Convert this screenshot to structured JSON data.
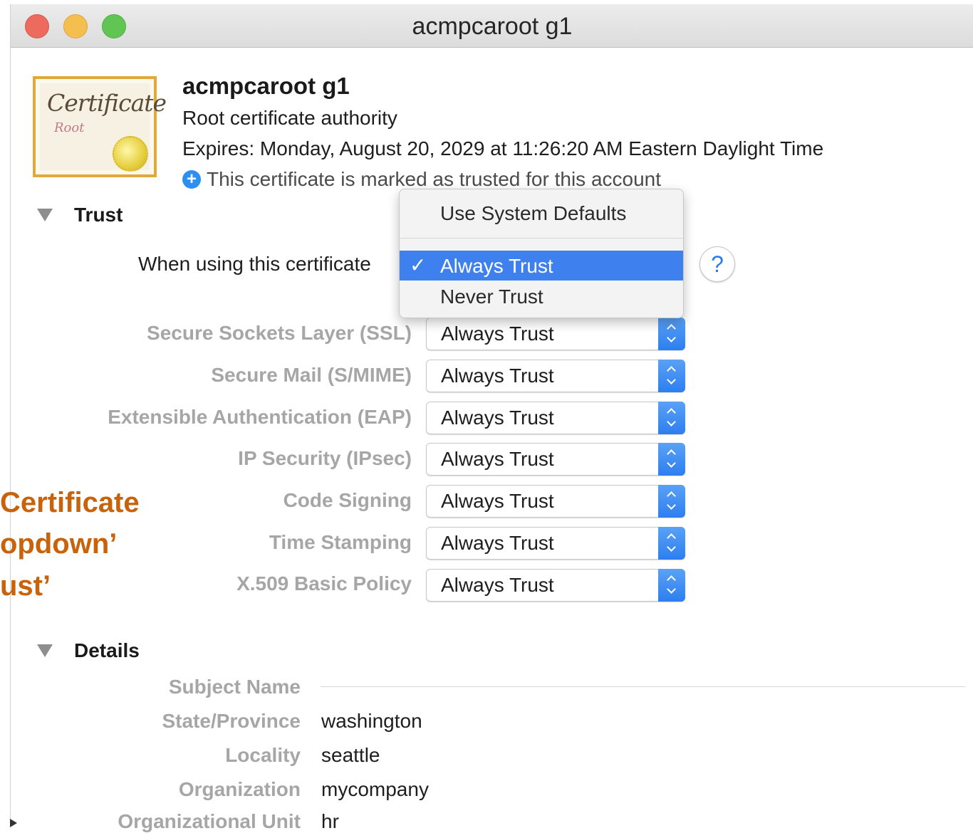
{
  "window": {
    "title": "acmpcaroot g1"
  },
  "certificate": {
    "icon_word": "Certificate",
    "icon_sub": "Root",
    "name": "acmpcaroot g1",
    "kind": "Root certificate authority",
    "expires": "Expires: Monday, August 20, 2029 at 11:26:20 AM Eastern Daylight Time",
    "trusted_note": "This certificate is marked as trusted for this account"
  },
  "trust": {
    "header": "Trust",
    "when_label": "When using this certificate",
    "help": "?",
    "menu": {
      "items": [
        "Use System Defaults",
        "Always Trust",
        "Never Trust"
      ],
      "selected": "Always Trust",
      "check": "✓"
    },
    "policies": [
      {
        "label": "Secure Sockets Layer (SSL)",
        "value": "Always Trust"
      },
      {
        "label": "Secure Mail (S/MIME)",
        "value": "Always Trust"
      },
      {
        "label": "Extensible Authentication (EAP)",
        "value": "Always Trust"
      },
      {
        "label": "IP Security (IPsec)",
        "value": "Always Trust"
      },
      {
        "label": "Code Signing",
        "value": "Always Trust"
      },
      {
        "label": "Time Stamping",
        "value": "Always Trust"
      },
      {
        "label": "X.509 Basic Policy",
        "value": "Always Trust"
      }
    ]
  },
  "overlay_text": [
    "Certificate",
    "opdown’",
    "ust’"
  ],
  "details": {
    "header": "Details",
    "subject_name": "Subject Name",
    "rows": [
      {
        "label": "State/Province",
        "value": "washington"
      },
      {
        "label": "Locality",
        "value": "seattle"
      },
      {
        "label": "Organization",
        "value": "mycompany"
      },
      {
        "label": "Organizational Unit",
        "value": "hr"
      }
    ]
  }
}
